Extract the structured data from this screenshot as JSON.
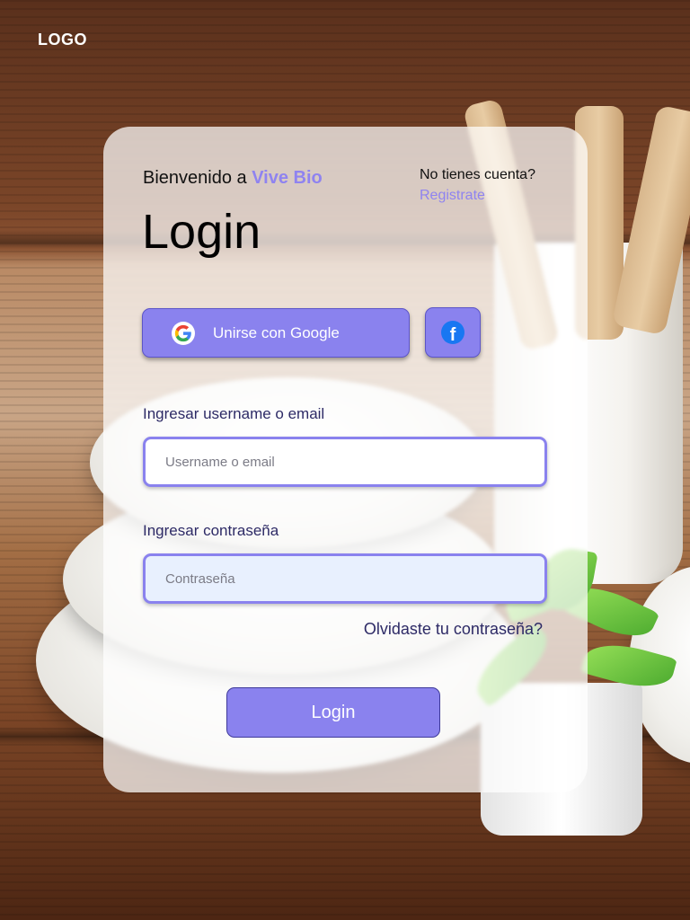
{
  "logo": {
    "text": "LOGO"
  },
  "card": {
    "welcome_prefix": "Bienvenido a ",
    "brand": "Vive Bio",
    "title": "Login",
    "signup_question": "No tienes cuenta?",
    "signup_link": "Registrate"
  },
  "social": {
    "google_label": "Unirse con Google",
    "google_icon": "google-icon",
    "facebook_icon": "facebook-icon"
  },
  "form": {
    "username_label": "Ingresar username o email",
    "username_placeholder": "Username o email",
    "password_label": "Ingresar contraseña",
    "password_placeholder": "Contraseña",
    "forgot_link": "Olvidaste tu contraseña?",
    "submit_label": "Login"
  },
  "colors": {
    "accent": "#8a82ee",
    "brand_text": "#8f83f0",
    "label_text": "#2d2a66",
    "password_field_bg": "#e8f0fe"
  }
}
